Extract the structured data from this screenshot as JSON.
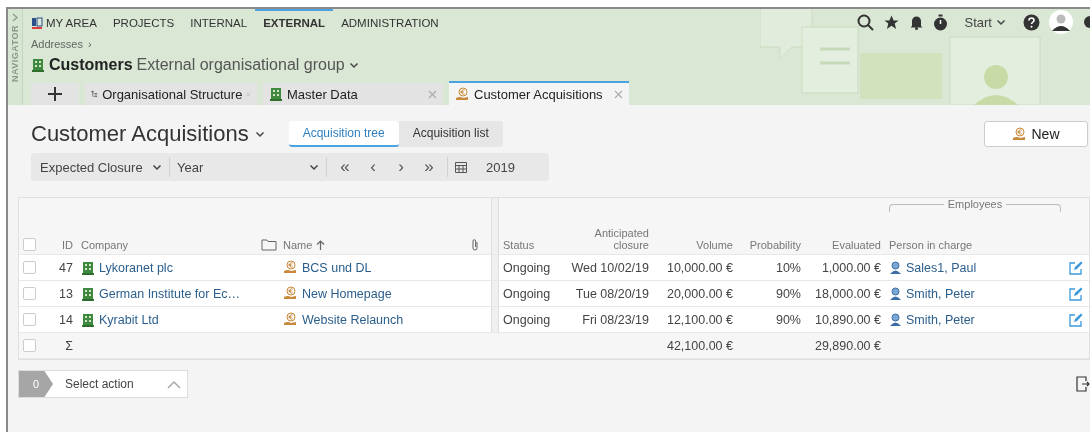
{
  "navigator": {
    "label": "NAVIGATOR"
  },
  "menu": [
    {
      "label": "MY AREA",
      "selected": false,
      "kind": "home"
    },
    {
      "label": "PROJECTS",
      "selected": false,
      "kind": "plain"
    },
    {
      "label": "INTERNAL",
      "selected": false,
      "kind": "plain"
    },
    {
      "label": "EXTERNAL",
      "selected": true,
      "kind": "plain"
    },
    {
      "label": "ADMINISTRATION",
      "selected": false,
      "kind": "plain"
    }
  ],
  "toolbar": {
    "start": "Start"
  },
  "breadcrumb": [
    "Addresses",
    "›"
  ],
  "context": {
    "title": "Customers",
    "subtitle": "External organisational group"
  },
  "tabs": [
    {
      "label": "Organisational Structure",
      "kind": "structure",
      "selected": false
    },
    {
      "label": "Master Data",
      "kind": "building",
      "selected": false
    },
    {
      "label": "Customer Acquisitions",
      "kind": "euro",
      "selected": true
    }
  ],
  "page": {
    "title": "Customer Acquisitions",
    "new_button": "New"
  },
  "views": [
    {
      "label": "Acquisition tree",
      "selected": true
    },
    {
      "label": "Acquisition list",
      "selected": false
    }
  ],
  "filter": {
    "field": "Expected Closure",
    "period": "Year",
    "nav": [
      "«",
      "‹",
      "›",
      "»"
    ],
    "year": "2019"
  },
  "table": {
    "group": "Employees",
    "header_checked": false,
    "columns": [
      {
        "label": "ID",
        "kind": "id"
      },
      {
        "label": "Company",
        "kind": "company"
      },
      {
        "label": "Name",
        "kind": "name"
      },
      {
        "label": "Status",
        "kind": "status"
      },
      {
        "label": "Anticipated closure",
        "kind": "closure"
      },
      {
        "label": "Volume",
        "kind": "volume"
      },
      {
        "label": "Probability",
        "kind": "probability"
      },
      {
        "label": "Evaluated",
        "kind": "evaluated"
      },
      {
        "label": "Person in charge",
        "kind": "person"
      }
    ],
    "rows": [
      {
        "checked": false,
        "id": "47",
        "company": "Lykoranet plc",
        "name": "BCS und DL",
        "status": "Ongoing",
        "closure": "Wed 10/02/19",
        "volume": "10,000.00 €",
        "probability": "10%",
        "evaluated": "1,000.00 €",
        "person": "Sales1, Paul"
      },
      {
        "checked": false,
        "id": "13",
        "company": "German Institute for Ec…",
        "name": "New Homepage",
        "status": "Ongoing",
        "closure": "Tue 08/20/19",
        "volume": "20,000.00 €",
        "probability": "90%",
        "evaluated": "18,000.00 €",
        "person": "Smith, Peter"
      },
      {
        "checked": false,
        "id": "14",
        "company": "Kyrabit Ltd",
        "name": "Website Relaunch",
        "status": "Ongoing",
        "closure": "Fri 08/23/19",
        "volume": "12,100.00 €",
        "probability": "90%",
        "evaluated": "10,890.00 €",
        "person": "Smith, Peter"
      }
    ],
    "totals": {
      "checked": false,
      "sigma": "Σ",
      "volume": "42,100.00 €",
      "evaluated": "29,890.00 €"
    }
  },
  "action_bar": {
    "count": "0",
    "label": "Select action"
  }
}
